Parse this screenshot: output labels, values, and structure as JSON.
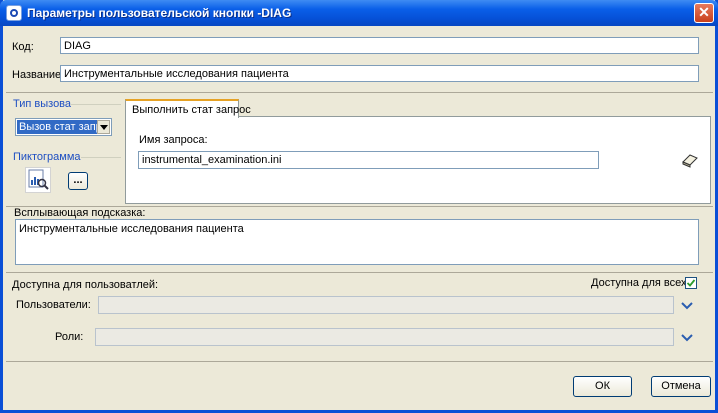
{
  "window": {
    "title": "Параметры пользовательской кнопки -DIAG",
    "close_label": "✕"
  },
  "form": {
    "code_label": "Код:",
    "code_value": "DIAG",
    "name_label": "Название:",
    "name_value": "Инструментальные исследования пациента"
  },
  "call_type": {
    "group_title": "Тип вызова",
    "selected": "Вызов стат запрос"
  },
  "pictogram": {
    "group_title": "Пиктограмма",
    "browse_label": "...",
    "icon": "report-chart-icon"
  },
  "tab": {
    "label": "Выполнить стат запрос",
    "query_label": "Имя запроса:",
    "query_value": "instrumental_examination.ini",
    "action_icon": "eraser-icon"
  },
  "tooltip": {
    "label": "Всплывающая подсказка:",
    "value": "Инструментальные исследования пациента"
  },
  "access": {
    "label": "Доступна для пользоватлей:",
    "all_label": "Доступна для всех",
    "all_checked": true,
    "users_label": "Пользователи:",
    "users_value": "",
    "roles_label": "Роли:",
    "roles_value": ""
  },
  "buttons": {
    "ok": "ОК",
    "cancel": "Отмена"
  },
  "colors": {
    "titlebar": "#0a5fe8",
    "group_title": "#1e4fc2",
    "selection": "#316ac5",
    "check": "#2c9b2c",
    "tab_accent": "#e6a225"
  }
}
